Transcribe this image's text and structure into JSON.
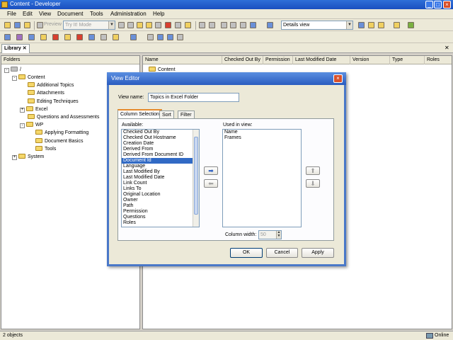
{
  "window": {
    "title": "Content - Developer"
  },
  "menu": [
    "File",
    "Edit",
    "View",
    "Document",
    "Tools",
    "Administration",
    "Help"
  ],
  "toolbar": {
    "preview_label": "Preview",
    "mode_combo": "Try It! Mode",
    "view_combo": "Details view"
  },
  "library_tab": "Library",
  "folders": {
    "header": "Folders",
    "root": "/",
    "items": [
      {
        "label": "Content",
        "level": 1,
        "expander": "-"
      },
      {
        "label": "Additional Topics",
        "level": 2,
        "expander": ""
      },
      {
        "label": "Attachments",
        "level": 2,
        "expander": ""
      },
      {
        "label": "Editing Techniques",
        "level": 2,
        "expander": ""
      },
      {
        "label": "Excel",
        "level": 2,
        "expander": "+"
      },
      {
        "label": "Questions and Assessments",
        "level": 2,
        "expander": ""
      },
      {
        "label": "WP",
        "level": 2,
        "expander": "-"
      },
      {
        "label": "Applying Formatting",
        "level": 3,
        "expander": ""
      },
      {
        "label": "Document Basics",
        "level": 3,
        "expander": ""
      },
      {
        "label": "Tools",
        "level": 3,
        "expander": ""
      },
      {
        "label": "System",
        "level": 1,
        "expander": "+"
      }
    ]
  },
  "content_list": {
    "columns": [
      "Name",
      "Checked Out By",
      "Permission",
      "Last Modified Date",
      "Version",
      "Type",
      "Roles"
    ],
    "rows": [
      "Content"
    ]
  },
  "dialog": {
    "title": "View Editor",
    "view_name_label": "View name:",
    "view_name_value": "Topics in Excel Folder",
    "tabs": [
      "Column Selection",
      "Sort",
      "Filter"
    ],
    "available_label": "Available:",
    "available": [
      "Checked Out By",
      "Checked Out Hostname",
      "Creation Date",
      "Derived From",
      "Derived From Document ID",
      "Document Id",
      "Language",
      "Last Modified By",
      "Last Modified Date",
      "Link Count",
      "Links To",
      "Original Location",
      "Owner",
      "Path",
      "Permission",
      "Questions",
      "Roles"
    ],
    "selected_available": "Document Id",
    "used_label": "Used in view:",
    "used": [
      "Name",
      "Frames"
    ],
    "column_width_label": "Column width:",
    "column_width_value": "50",
    "ok": "OK",
    "cancel": "Cancel",
    "apply": "Apply"
  },
  "status": {
    "left": "2 objects",
    "right": "Online"
  }
}
